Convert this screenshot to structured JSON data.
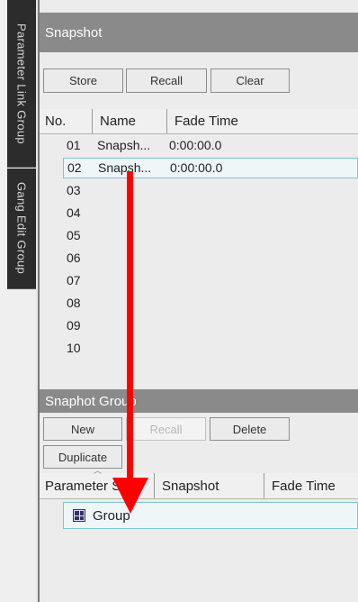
{
  "sidebar": {
    "tabs": [
      {
        "label": "Parameter Link Group"
      },
      {
        "label": "Gang Edit Group"
      }
    ]
  },
  "snapshot": {
    "title": "Snapshot",
    "buttons": {
      "store": "Store",
      "recall": "Recall",
      "clear": "Clear"
    },
    "columns": {
      "no": "No.",
      "name": "Name",
      "fade": "Fade Time"
    },
    "rows": [
      {
        "no": "01",
        "name": "Snapsh...",
        "fade": "0:00:00.0"
      },
      {
        "no": "02",
        "name": "Snapsh...",
        "fade": "0:00:00.0"
      },
      {
        "no": "03",
        "name": "",
        "fade": ""
      },
      {
        "no": "04",
        "name": "",
        "fade": ""
      },
      {
        "no": "05",
        "name": "",
        "fade": ""
      },
      {
        "no": "06",
        "name": "",
        "fade": ""
      },
      {
        "no": "07",
        "name": "",
        "fade": ""
      },
      {
        "no": "08",
        "name": "",
        "fade": ""
      },
      {
        "no": "09",
        "name": "",
        "fade": ""
      },
      {
        "no": "10",
        "name": "",
        "fade": ""
      }
    ]
  },
  "snapshot_group": {
    "title": "Snaphot Group",
    "buttons": {
      "new": "New",
      "recall": "Recall",
      "delete": "Delete",
      "duplicate": "Duplicate"
    },
    "columns": {
      "parameter": "Parameter Set",
      "snapshot": "Snapshot",
      "fade": "Fade Time"
    },
    "group_row": {
      "label": "Group",
      "icon": "group-icon"
    }
  },
  "annotation": {
    "arrow_color": "#ff0000"
  }
}
